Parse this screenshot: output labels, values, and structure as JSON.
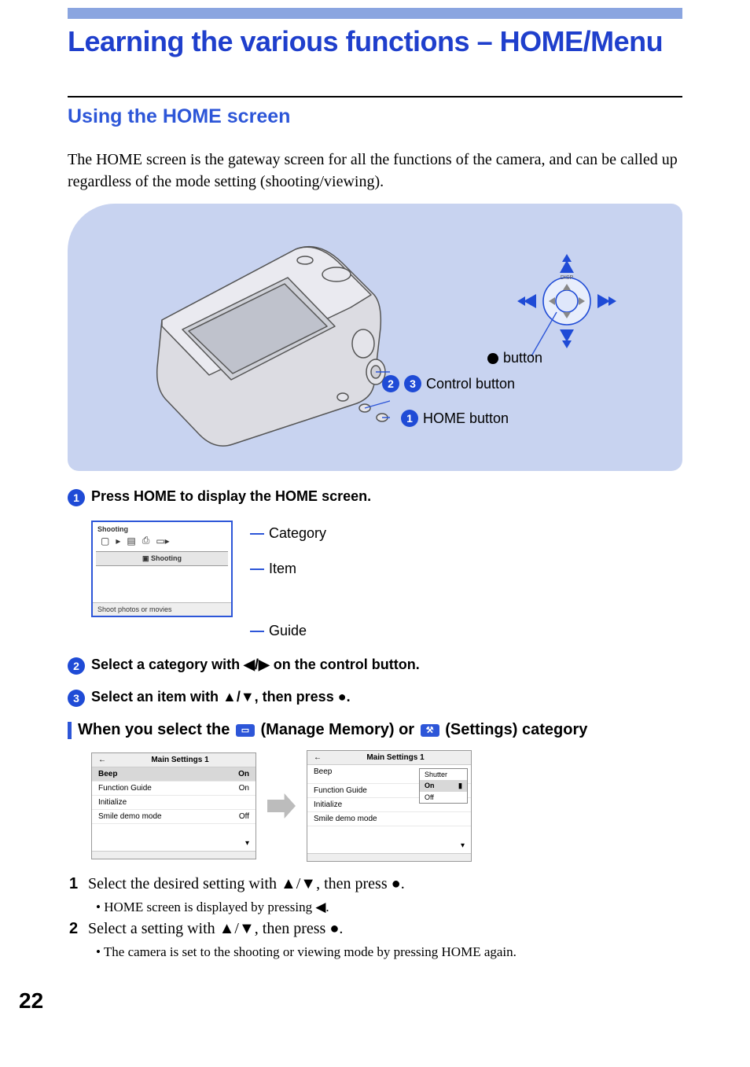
{
  "page": {
    "title": "Learning the various functions – HOME/Menu",
    "section_heading": "Using the HOME screen",
    "intro": "The HOME screen is the gateway screen for all the functions of the camera, and can be called up regardless of the mode setting (shooting/viewing).",
    "page_number": "22"
  },
  "diagram": {
    "disp_label": "DISP",
    "button_label_prefix": "● ",
    "button_label": "button",
    "control_button": "Control button",
    "home_button": "HOME button"
  },
  "callouts": {
    "n1": "1",
    "n2": "2",
    "n3": "3"
  },
  "steps": {
    "s1": "Press HOME to display the HOME screen.",
    "s2": "Select a category with ◀/▶ on the control button.",
    "s3": "Select an item with ▲/▼, then press ●."
  },
  "home_lcd": {
    "category_title": "Shooting",
    "item_label": "Shooting",
    "guide_text": "Shoot photos or movies"
  },
  "pointer": {
    "category": "Category",
    "item": "Item",
    "guide": "Guide"
  },
  "subheading": {
    "prefix": "When you select the ",
    "mm_label": "(Manage Memory) or ",
    "settings_label": "(Settings) category"
  },
  "settings_panel": {
    "header_arrow": "←",
    "header": "Main Settings 1",
    "rows": [
      {
        "label": "Beep",
        "value": "On",
        "selected": true
      },
      {
        "label": "Function Guide",
        "value": "On"
      },
      {
        "label": "Initialize",
        "value": ""
      },
      {
        "label": "Smile demo mode",
        "value": "Off"
      }
    ],
    "down": "▾"
  },
  "settings_popup": {
    "rows": [
      {
        "label": "Shutter",
        "sel": false
      },
      {
        "label": "On",
        "mark": "▮",
        "sel": true
      },
      {
        "label": "Off",
        "sel": false
      }
    ]
  },
  "ordered": {
    "s1n": "1",
    "s1": "Select the desired setting with ▲/▼, then press ●.",
    "s1b": "• HOME screen is displayed by pressing ◀.",
    "s2n": "2",
    "s2": "Select a setting with ▲/▼, then press ●.",
    "s2b": "• The camera is set to the shooting or viewing mode by pressing HOME again."
  }
}
